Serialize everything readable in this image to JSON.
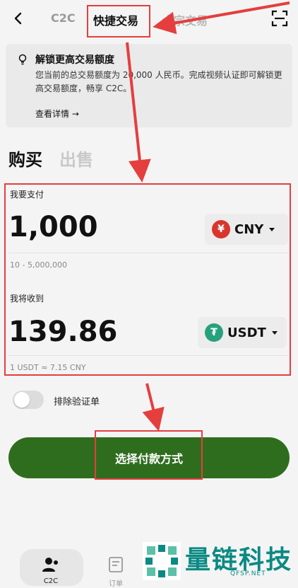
{
  "nav": {
    "tabs": [
      "C2C",
      "快捷交易",
      "大宗交易"
    ]
  },
  "notice": {
    "title": "解锁更高交易额度",
    "body": "您当前的总交易额度为 20,000 人民币。完成视频认证即可解锁更高交易额度，畅享 C2C。",
    "link": "查看详情 →"
  },
  "side": {
    "buy": "购买",
    "sell": "出售"
  },
  "pay": {
    "label": "我要支付",
    "amount": "1,000",
    "currency": "CNY",
    "currency_symbol": "¥",
    "range": "10 - 5,000,000"
  },
  "receive": {
    "label": "我将收到",
    "amount": "139.86",
    "currency": "USDT",
    "currency_symbol": "₮",
    "rate": "1 USDT ≈ 7.15 CNY"
  },
  "toggle": {
    "label": "排除验证单",
    "on": false
  },
  "cta": {
    "label": "选择付款方式"
  },
  "bottom_nav": [
    {
      "label": "C2C",
      "icon": "user-icon"
    },
    {
      "label": "订单",
      "icon": "order-icon"
    }
  ],
  "watermark": {
    "text": "量链科技",
    "sub": "QFSP.NET"
  },
  "colors": {
    "accent": "#2f6d1e",
    "cny": "#d9362b",
    "usdt": "#26a17b",
    "annotation": "#e53e3e"
  }
}
